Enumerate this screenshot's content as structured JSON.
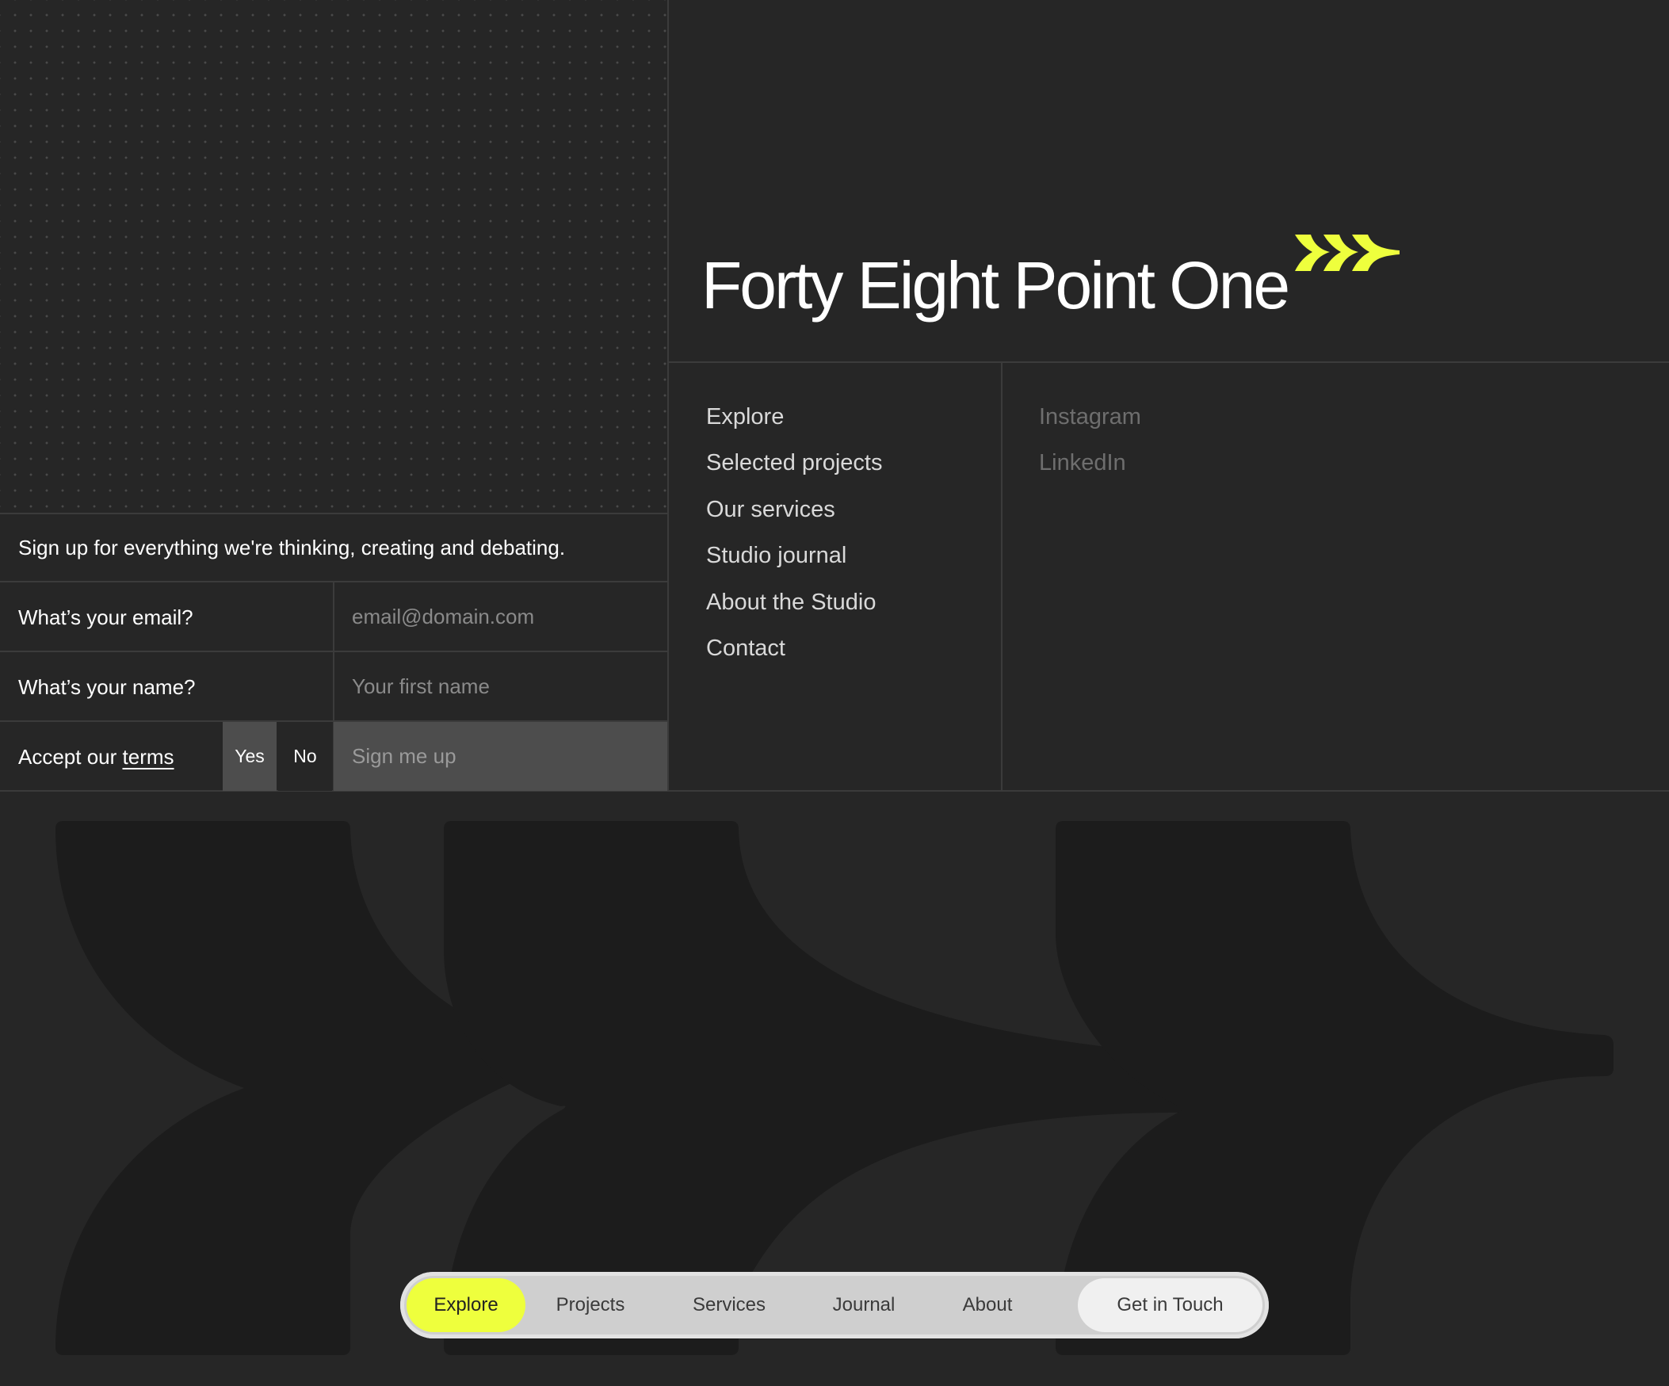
{
  "brand": {
    "name": "Forty Eight Point One",
    "accent_color": "#eeff3d",
    "mark_icon": "triple-arrow-icon"
  },
  "footer_nav": {
    "items": [
      "Explore",
      "Selected projects",
      "Our services",
      "Studio journal",
      "About the Studio",
      "Contact"
    ]
  },
  "social": {
    "items": [
      "Instagram",
      "LinkedIn"
    ]
  },
  "newsletter": {
    "heading": "Sign up for everything we're thinking, creating and debating.",
    "email_label": "What’s your email?",
    "email_placeholder": "email@domain.com",
    "name_label": "What’s your name?",
    "name_placeholder": "Your first name",
    "terms_prefix": "Accept our ",
    "terms_link": "terms",
    "yes_label": "Yes",
    "no_label": "No",
    "submit_label": "Sign me up"
  },
  "bottom_nav": {
    "items": [
      "Explore",
      "Projects",
      "Services",
      "Journal",
      "About"
    ],
    "active": "Explore",
    "cta_label": "Get in Touch"
  }
}
